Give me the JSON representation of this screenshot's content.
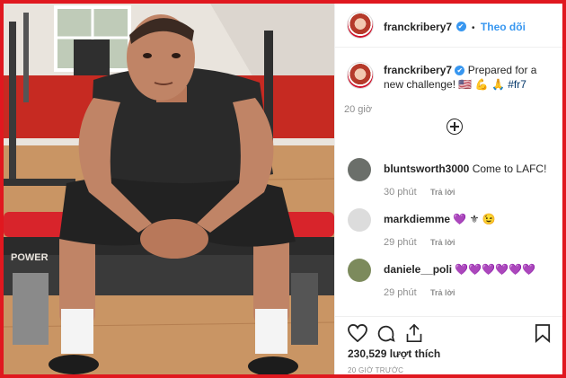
{
  "post": {
    "username": "franckribery7",
    "verified_mark": "✔",
    "separator": "•",
    "follow_label": "Theo dõi"
  },
  "caption": {
    "username": "franckribery7",
    "text": "Prepared for a new challenge!",
    "emojis": "🇺🇸 💪 🙏",
    "hashtag": "#fr7",
    "time": "20 giờ"
  },
  "load_more_icon": "plus-circle-icon",
  "comments": [
    {
      "username": "bluntsworth3000",
      "text": "Come to LAFC!",
      "time": "30 phút",
      "reply": "Trả lời",
      "avatar_color": "#6b6f6a"
    },
    {
      "username": "markdiemme",
      "text": "💜 ⚜ 😉",
      "time": "29 phút",
      "reply": "Trả lời",
      "avatar_color": "#dcdcdc"
    },
    {
      "username": "daniele__poli",
      "text": "💜💜💜💜💜💜",
      "time": "29 phút",
      "reply": "Trả lời",
      "avatar_color": "#7c8a5c"
    }
  ],
  "actions": {
    "like_icon": "heart-icon",
    "comment_icon": "comment-icon",
    "share_icon": "share-icon",
    "save_icon": "bookmark-icon",
    "likes_text": "230,529 lượt thích",
    "ago_text": "20 GIỜ TRƯỚC"
  },
  "colors": {
    "border_red": "#e0181f",
    "link_blue": "#3897f0",
    "muted_gray": "#8e8e8e"
  }
}
